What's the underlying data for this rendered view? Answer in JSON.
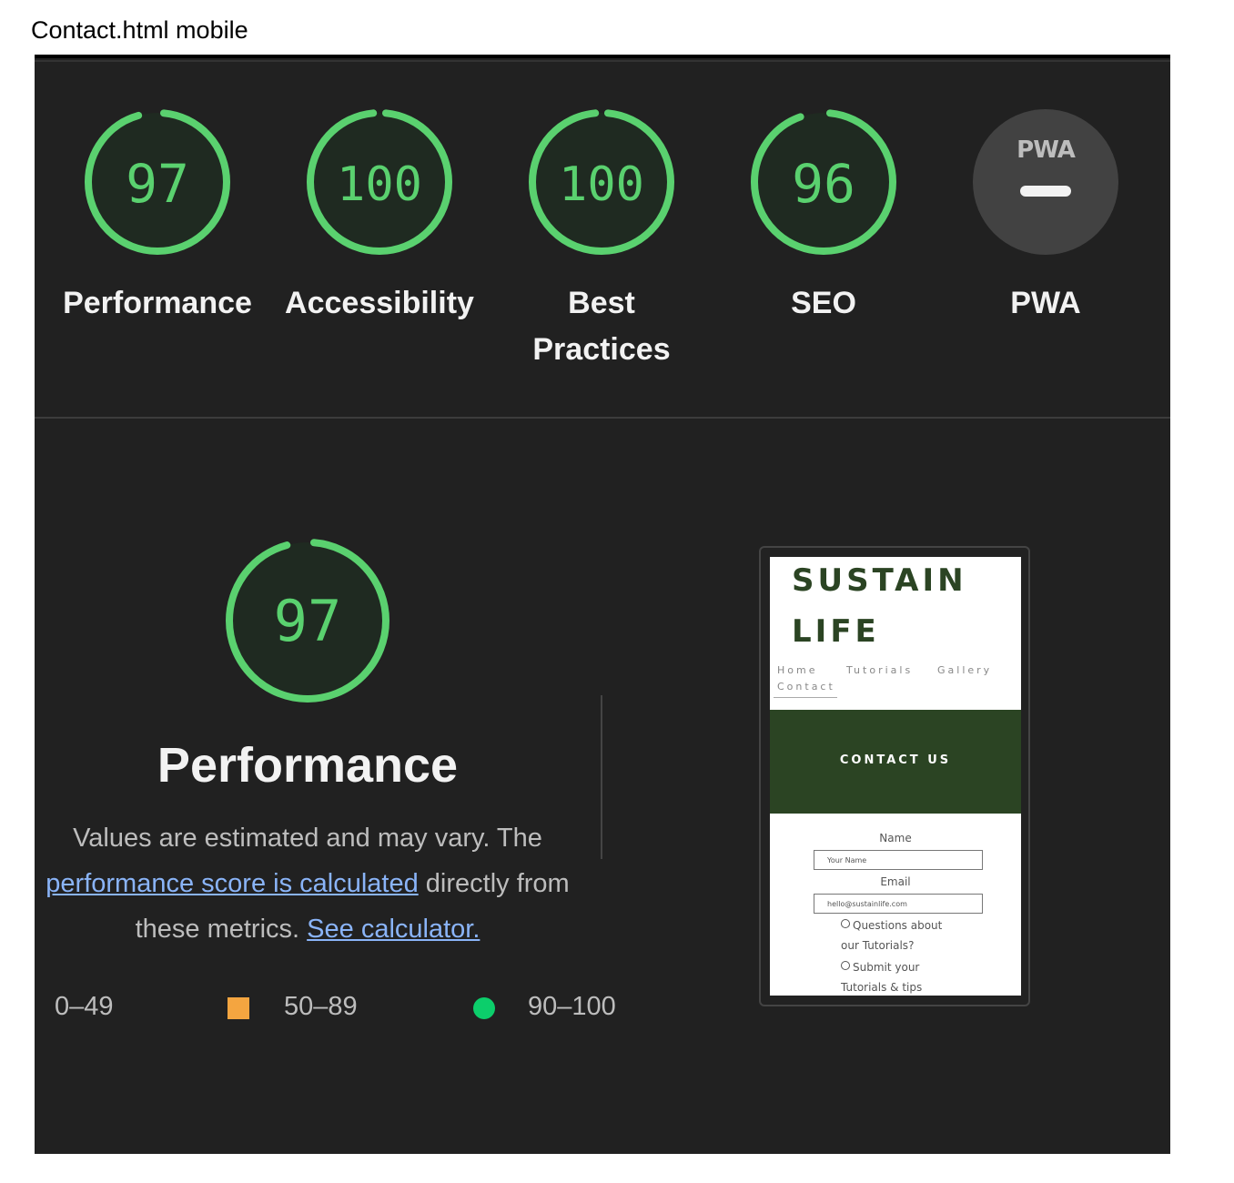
{
  "caption": "Contact.html mobile",
  "gauges": [
    {
      "score": "97",
      "label": "Performance",
      "value": 97
    },
    {
      "score": "100",
      "label": "Accessibility",
      "value": 100
    },
    {
      "score": "100",
      "label": "Best Practices",
      "value": 100
    },
    {
      "score": "96",
      "label": "SEO",
      "value": 96
    },
    {
      "score": "PWA",
      "label": "PWA",
      "value": null
    }
  ],
  "pwa_logo": "PWA",
  "performance": {
    "score": "97",
    "title": "Performance",
    "desc_1": "Values are estimated and may vary. The ",
    "desc_link1": "performance score is calculated",
    "desc_2": " directly from these metrics. ",
    "desc_link2": "See calculator."
  },
  "legend": {
    "fail": "0–49",
    "average": "50–89",
    "pass": "90–100"
  },
  "colors": {
    "pass": "#0cce6b",
    "average": "#f4a540",
    "score_text": "#5ad16f"
  },
  "preview": {
    "brand_line1": "SUSTAIN",
    "brand_line2": "LIFE",
    "nav": [
      "Home",
      "Tutorials",
      "Gallery",
      "Contact"
    ],
    "hero": "CONTACT US",
    "name_label": "Name",
    "name_placeholder": "Your Name",
    "email_label": "Email",
    "email_placeholder": "hello@sustainlife.com",
    "radio1_a": "Questions about",
    "radio1_b": "our Tutorials?",
    "radio2_a": "Submit your",
    "radio2_b": "Tutorials & tips"
  }
}
